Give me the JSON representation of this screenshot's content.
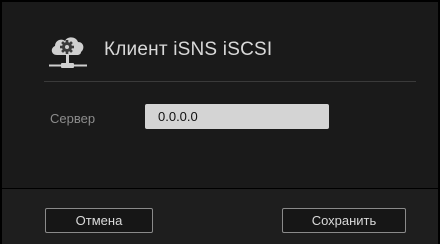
{
  "dialog": {
    "title": "Клиент iSNS iSCSI",
    "icon": "network-settings-icon"
  },
  "form": {
    "server_label": "Сервер",
    "server_value": "0.0.0.0"
  },
  "footer": {
    "cancel_label": "Отмена",
    "save_label": "Сохранить"
  },
  "colors": {
    "background": "#1a1a1a",
    "footer_background": "#1e1e1e",
    "input_background": "#d4d4d4",
    "title_text": "#d9d9d9",
    "label_text": "#8c8c8c",
    "button_border": "#8a8a8a"
  }
}
